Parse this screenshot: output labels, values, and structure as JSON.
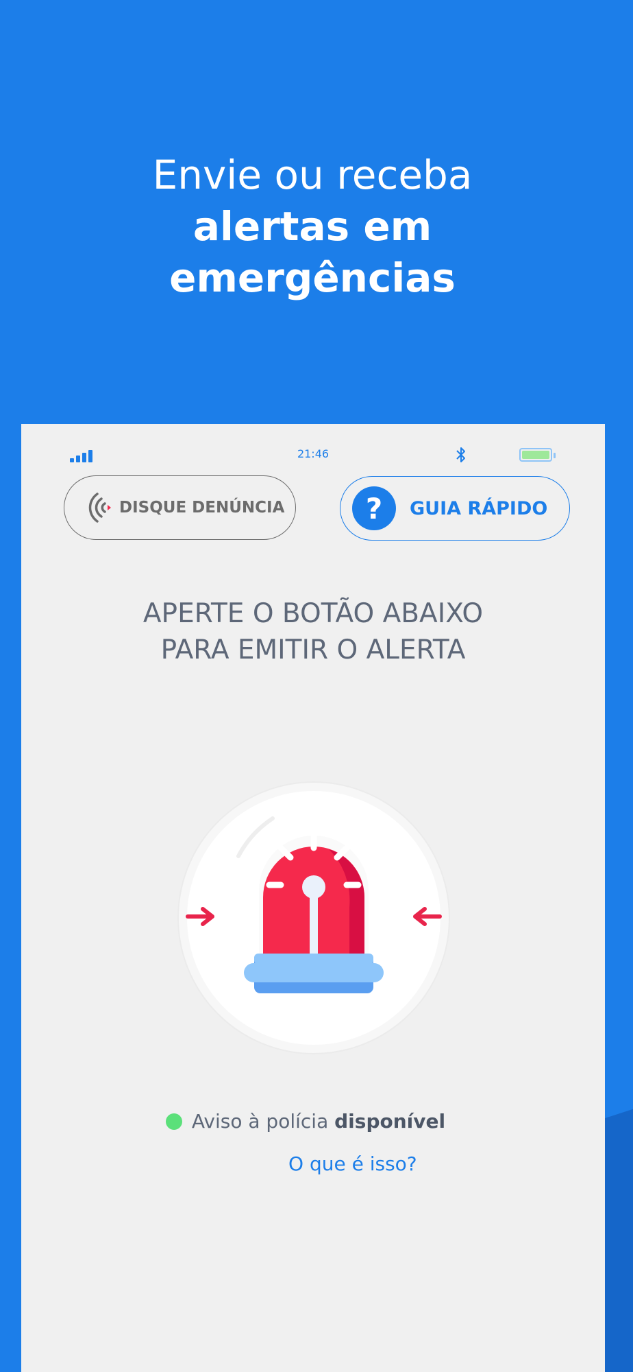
{
  "headline": {
    "line1": "Envie ou receba",
    "line2": "alertas em",
    "line3": "emergências"
  },
  "status_bar": {
    "time": "21:46",
    "icons": [
      "signal-icon",
      "bluetooth-icon",
      "battery-icon"
    ]
  },
  "buttons": {
    "denuncia_label": "DISQUE DENÚNCIA",
    "guia_label": "GUIA RÁPIDO",
    "guia_icon_glyph": "?"
  },
  "instruction": {
    "line1": "APERTE O BOTÃO ABAIXO",
    "line2": "PARA EMITIR O ALERTA"
  },
  "police": {
    "prefix": "Aviso à polícia",
    "status": "disponível",
    "status_color": "#5be07a",
    "link": "O que é isso?"
  },
  "colors": {
    "brand_blue": "#1c7ee9",
    "siren_red": "#f5294c",
    "text_gray": "#5d6778"
  }
}
